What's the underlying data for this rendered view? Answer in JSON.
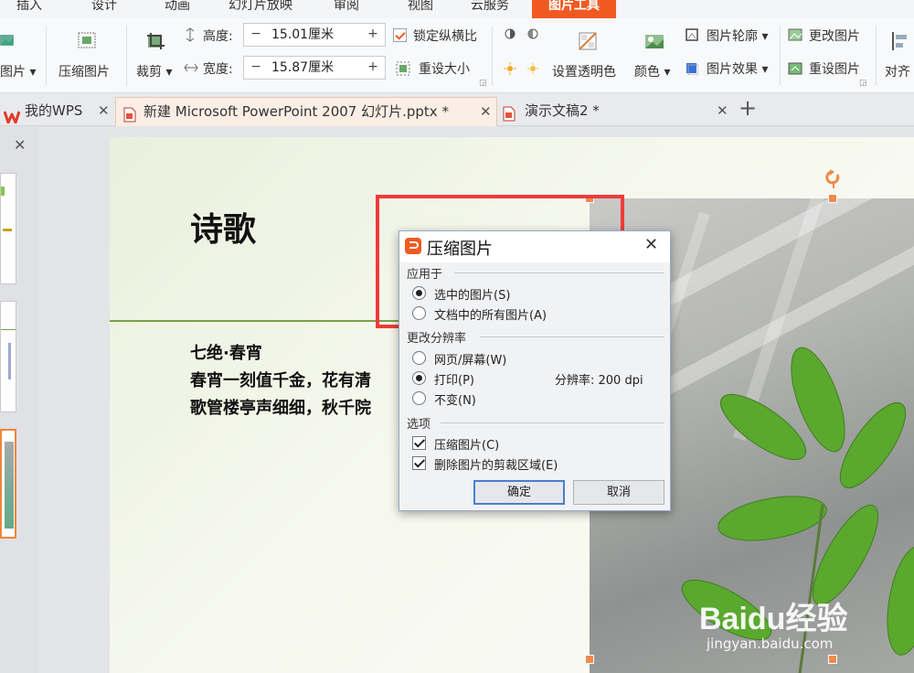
{
  "menu": {
    "tabs": [
      "插入",
      "设计",
      "动画",
      "幻灯片放映",
      "审阅",
      "视图",
      "云服务",
      "图片工具"
    ],
    "active": "图片工具"
  },
  "ribbon": {
    "image_label": "图片",
    "compress_label": "压缩图片",
    "crop_label": "裁剪",
    "height_label": "高度:",
    "height_value": "15.01厘米",
    "width_label": "宽度:",
    "width_value": "15.87厘米",
    "lock_ratio_label": "锁定纵横比",
    "reset_size_label": "重设大小",
    "transparent_label": "设置透明色",
    "color_label": "颜色",
    "outline_label": "图片轮廓",
    "effect_label": "图片效果",
    "change_image_label": "更改图片",
    "reset_image_label": "重设图片",
    "align_label": "对齐",
    "minus": "−",
    "plus": "+"
  },
  "doc_tabs": [
    {
      "label": "我的WPS"
    },
    {
      "label": "新建 Microsoft PowerPoint 2007 幻灯片.pptx *"
    },
    {
      "label": "演示文稿2 *"
    }
  ],
  "slide": {
    "title": "诗歌",
    "poem_title": "七绝·春宵",
    "line1": "春宵一刻值千金，花有清",
    "line2": "歌管楼亭声细细，秋千院"
  },
  "dialog": {
    "title": "压缩图片",
    "apply_group": "应用于",
    "opt_selected": "选中的图片(S)",
    "opt_all": "文档中的所有图片(A)",
    "resolution_group": "更改分辨率",
    "opt_web": "网页/屏幕(W)",
    "opt_print": "打印(P)",
    "resolution_text": "分辨率: 200 dpi",
    "opt_keep": "不变(N)",
    "options_group": "选项",
    "chk_compress": "压缩图片(C)",
    "chk_delete_crop": "删除图片的剪裁区域(E)",
    "ok": "确定",
    "cancel": "取消",
    "apply_selection": "selected",
    "resolution_selection": "print",
    "compress_checked": true,
    "delete_crop_checked": true
  },
  "watermark": {
    "brand": "Baidu经验",
    "url": "jingyan.baidu.com"
  },
  "colors": {
    "accent": "#f05a22",
    "highlight_box": "#ee3b3b"
  },
  "icons": [
    "image-icon",
    "compress-icon",
    "crop-icon",
    "height-icon",
    "width-icon",
    "resize-icon",
    "transparent-icon",
    "color-icon",
    "outline-icon",
    "effect-icon",
    "change-image-icon",
    "reset-image-icon",
    "align-icon",
    "wps-logo-icon",
    "close-icon",
    "add-tab-icon",
    "rotate-handle-icon"
  ]
}
